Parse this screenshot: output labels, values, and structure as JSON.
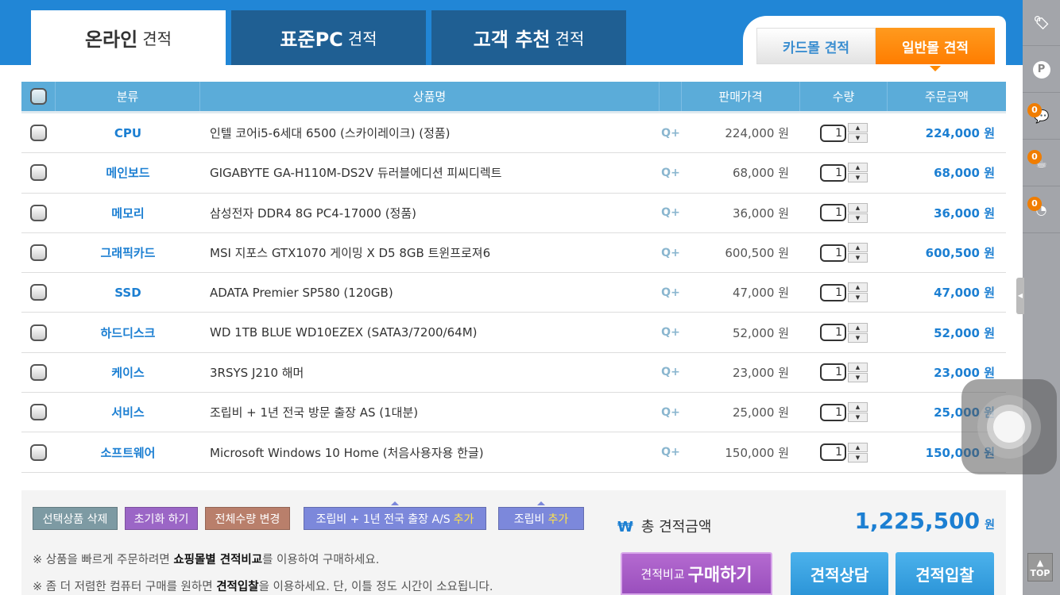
{
  "tabs": [
    {
      "main": "온라인",
      "sub": "견적"
    },
    {
      "main": "표준PC",
      "sub": "견적"
    },
    {
      "main": "고객 추천",
      "sub": "견적"
    }
  ],
  "malls": {
    "card": "카드몰 견적",
    "general": "일반몰 견적"
  },
  "headers": {
    "category": "분류",
    "product": "상품명",
    "price": "판매가격",
    "qty": "수량",
    "amount": "주문금액"
  },
  "rows": [
    {
      "category": "CPU",
      "product": "인텔 코어i5-6세대 6500 (스카이레이크) (정품)",
      "price": "224,000 원",
      "qty": "1",
      "amount": "224,000 원"
    },
    {
      "category": "메인보드",
      "product": "GIGABYTE GA-H110M-DS2V 듀러블에디션 피씨디렉트",
      "price": "68,000 원",
      "qty": "1",
      "amount": "68,000 원"
    },
    {
      "category": "메모리",
      "product": "삼성전자 DDR4 8G PC4-17000 (정품)",
      "price": "36,000 원",
      "qty": "1",
      "amount": "36,000 원"
    },
    {
      "category": "그래픽카드",
      "product": "MSI 지포스 GTX1070 게이밍 X D5 8GB 트윈프로져6",
      "price": "600,500 원",
      "qty": "1",
      "amount": "600,500 원"
    },
    {
      "category": "SSD",
      "product": "ADATA Premier SP580 (120GB)",
      "price": "47,000 원",
      "qty": "1",
      "amount": "47,000 원"
    },
    {
      "category": "하드디스크",
      "product": "WD 1TB BLUE WD10EZEX (SATA3/7200/64M)",
      "price": "52,000 원",
      "qty": "1",
      "amount": "52,000 원"
    },
    {
      "category": "케이스",
      "product": "3RSYS J210 해머",
      "price": "23,000 원",
      "qty": "1",
      "amount": "23,000 원"
    },
    {
      "category": "서비스",
      "product": "조립비 + 1년 전국 방문 출장 AS (1대분)",
      "price": "25,000 원",
      "qty": "1",
      "amount": "25,000 원"
    },
    {
      "category": "소프트웨어",
      "product": "Microsoft Windows 10 Home (처음사용자용 한글)",
      "price": "150,000 원",
      "qty": "1",
      "amount": "150,000 원"
    }
  ],
  "zoom_label": "Q+",
  "actions": {
    "delete": "선택상품 삭제",
    "reset": "초기화 하기",
    "change_qty": "전체수량 변경",
    "add_as": "조립비 + 1년 전국 출장 A/S",
    "add_assembly": "조립비",
    "add": "추가"
  },
  "notes": [
    {
      "pre": "※ 상품을 빠르게 주문하려면 ",
      "bold": "쇼핑몰별 견적비교",
      "post": "를 이용하여 구매하세요."
    },
    {
      "pre": "※ 좀 더 저렴한 컴퓨터 구매를 원하면 ",
      "bold": "견적입찰",
      "post": "을 이용하세요. 단, 이틀 정도 시간이 소요됩니다."
    }
  ],
  "total": {
    "currency": "₩",
    "label": "총 견적금액",
    "value": "1,225,500",
    "unit": "원"
  },
  "buttons": {
    "compare_small": "견적비교",
    "compare_big": "구매하기",
    "consult": "견적상담",
    "bid": "견적입찰"
  },
  "sidebar": {
    "badges": [
      "0",
      "0",
      "0"
    ],
    "top": "TOP",
    "p": "P"
  }
}
